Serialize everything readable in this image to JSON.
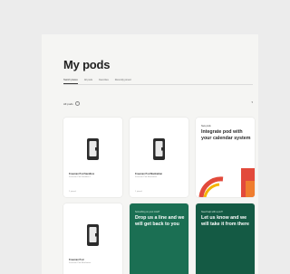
{
  "page": {
    "title": "My pods"
  },
  "tabs": [
    {
      "label": "Switch places",
      "active": true
    },
    {
      "label": "All pods",
      "active": false
    },
    {
      "label": "Favorites",
      "active": false
    },
    {
      "label": "Recently joined",
      "active": false
    }
  ],
  "filter": {
    "label": "All pods",
    "icon": "info-icon"
  },
  "sort": {
    "icon": "sort-icon"
  },
  "pods": [
    {
      "name": "Freeman Pod Sandbox",
      "sub": "Freeman Pod Sandbox 1",
      "status": "2 joined",
      "icon": "pod-icon"
    },
    {
      "name": "Freeman Pod Manhattan",
      "sub": "Freeman Pod Manhattan",
      "status": "1 joined",
      "icon": "pod-icon"
    },
    {
      "name": "Freeman Pod",
      "sub": "Freeman Pod Manhattan",
      "status": "",
      "icon": "pod-icon"
    }
  ],
  "promo": {
    "kicker": "New pods",
    "title": "Integrate pod with your calendar system",
    "colors": {
      "red": "#e24a3b",
      "yellow": "#f4b400",
      "orange": "#ef7d2e"
    }
  },
  "cta_cards": [
    {
      "kicker": "Something on your mind?",
      "title": "Drop us a line and we will get back to you"
    },
    {
      "kicker": "Need help with a pod?",
      "title": "Let us know and we will take it from there"
    }
  ],
  "colors": {
    "green": "#1b6f53",
    "green_dark": "#145a44",
    "background": "#f5f5f3"
  }
}
